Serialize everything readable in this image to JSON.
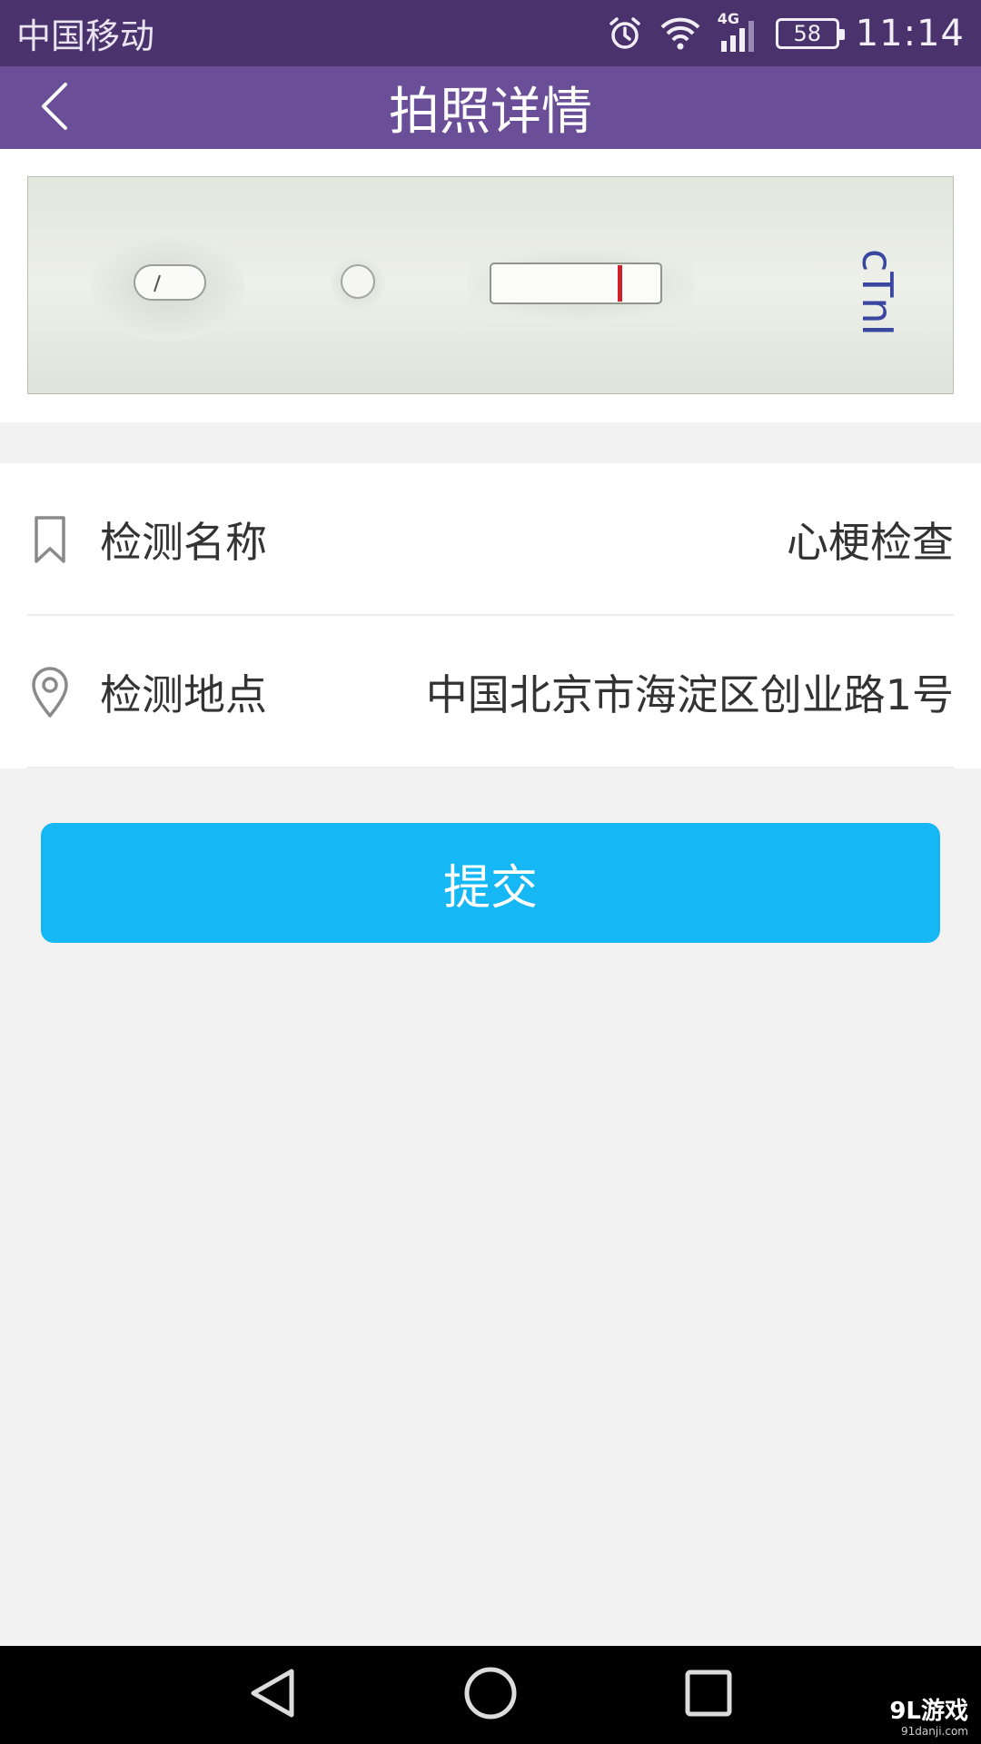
{
  "status_bar": {
    "carrier": "中国移动",
    "network": "4G",
    "battery": "58",
    "time": "11:14"
  },
  "header": {
    "title": "拍照详情",
    "back_icon": "chevron-left-icon"
  },
  "photo": {
    "strip_label": "cTnI"
  },
  "details": [
    {
      "icon": "bookmark-icon",
      "label": "检测名称",
      "value": "心梗检查"
    },
    {
      "icon": "location-pin-icon",
      "label": "检测地点",
      "value": "中国北京市海淀区创业路1号"
    }
  ],
  "submit": {
    "label": "提交"
  },
  "nav": {
    "back_icon": "triangle-back-icon",
    "home_icon": "circle-home-icon",
    "recent_icon": "square-recent-icon"
  },
  "watermark": {
    "main": "9L游戏",
    "sub": "91danji.com"
  },
  "colors": {
    "status_bar": "#4a336d",
    "title_bar": "#6a4e98",
    "button": "#16b7f5",
    "background": "#f2f2f2"
  }
}
